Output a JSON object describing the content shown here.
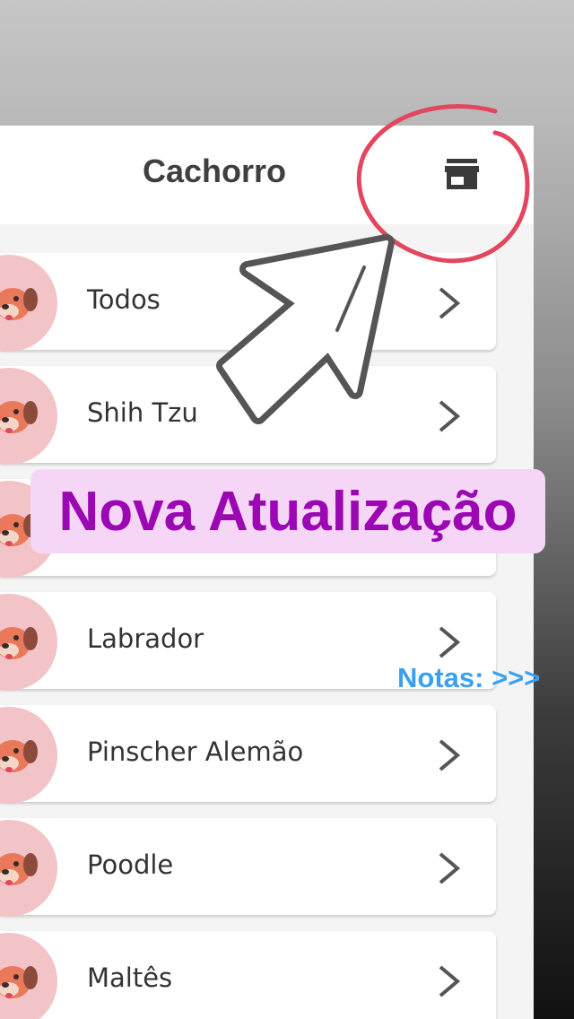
{
  "header": {
    "title": "Cachorro",
    "store_icon": "store-icon"
  },
  "breeds": [
    {
      "label": "Todos",
      "icon": "dog-face-icon"
    },
    {
      "label": "Shih Tzu",
      "icon": "dog-face-icon"
    },
    {
      "label": "",
      "icon": "dog-face-icon"
    },
    {
      "label": "Labrador",
      "icon": "dog-face-icon"
    },
    {
      "label": "Pinscher Alemão",
      "icon": "dog-face-icon"
    },
    {
      "label": "Poodle",
      "icon": "dog-face-icon"
    },
    {
      "label": "Maltês",
      "icon": "dog-face-icon"
    }
  ],
  "overlay": {
    "banner_text": "Nova Atualização",
    "notes_text": "Notas: >>>",
    "banner_color": "#9b07b3",
    "banner_bg": "#f6d6f6",
    "notes_color": "#3aa0f0",
    "circle_color": "#e2475f"
  }
}
